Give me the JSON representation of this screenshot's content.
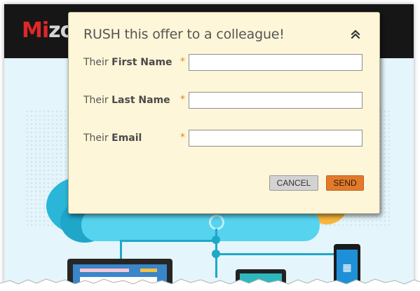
{
  "page": {
    "logo_part1": "Mi",
    "logo_part2": "zo"
  },
  "modal": {
    "title": "RUSH this offer to a colleague!",
    "collapse_icon": "double-chevron-up-icon",
    "fields": [
      {
        "label_prefix": "Their",
        "label_bold": "First Name",
        "required_mark": "*",
        "value": ""
      },
      {
        "label_prefix": "Their",
        "label_bold": "Last Name",
        "required_mark": "*",
        "value": ""
      },
      {
        "label_prefix": "Their",
        "label_bold": "Email",
        "required_mark": "*",
        "value": ""
      }
    ],
    "cancel_label": "CANCEL",
    "send_label": "SEND"
  },
  "colors": {
    "modal_bg": "#fdf6d8",
    "send_button": "#e27a2b",
    "cancel_button": "#d3d3d3",
    "required_asterisk": "#e0842c",
    "logo_accent": "#e02727",
    "header_bg": "#161616"
  }
}
